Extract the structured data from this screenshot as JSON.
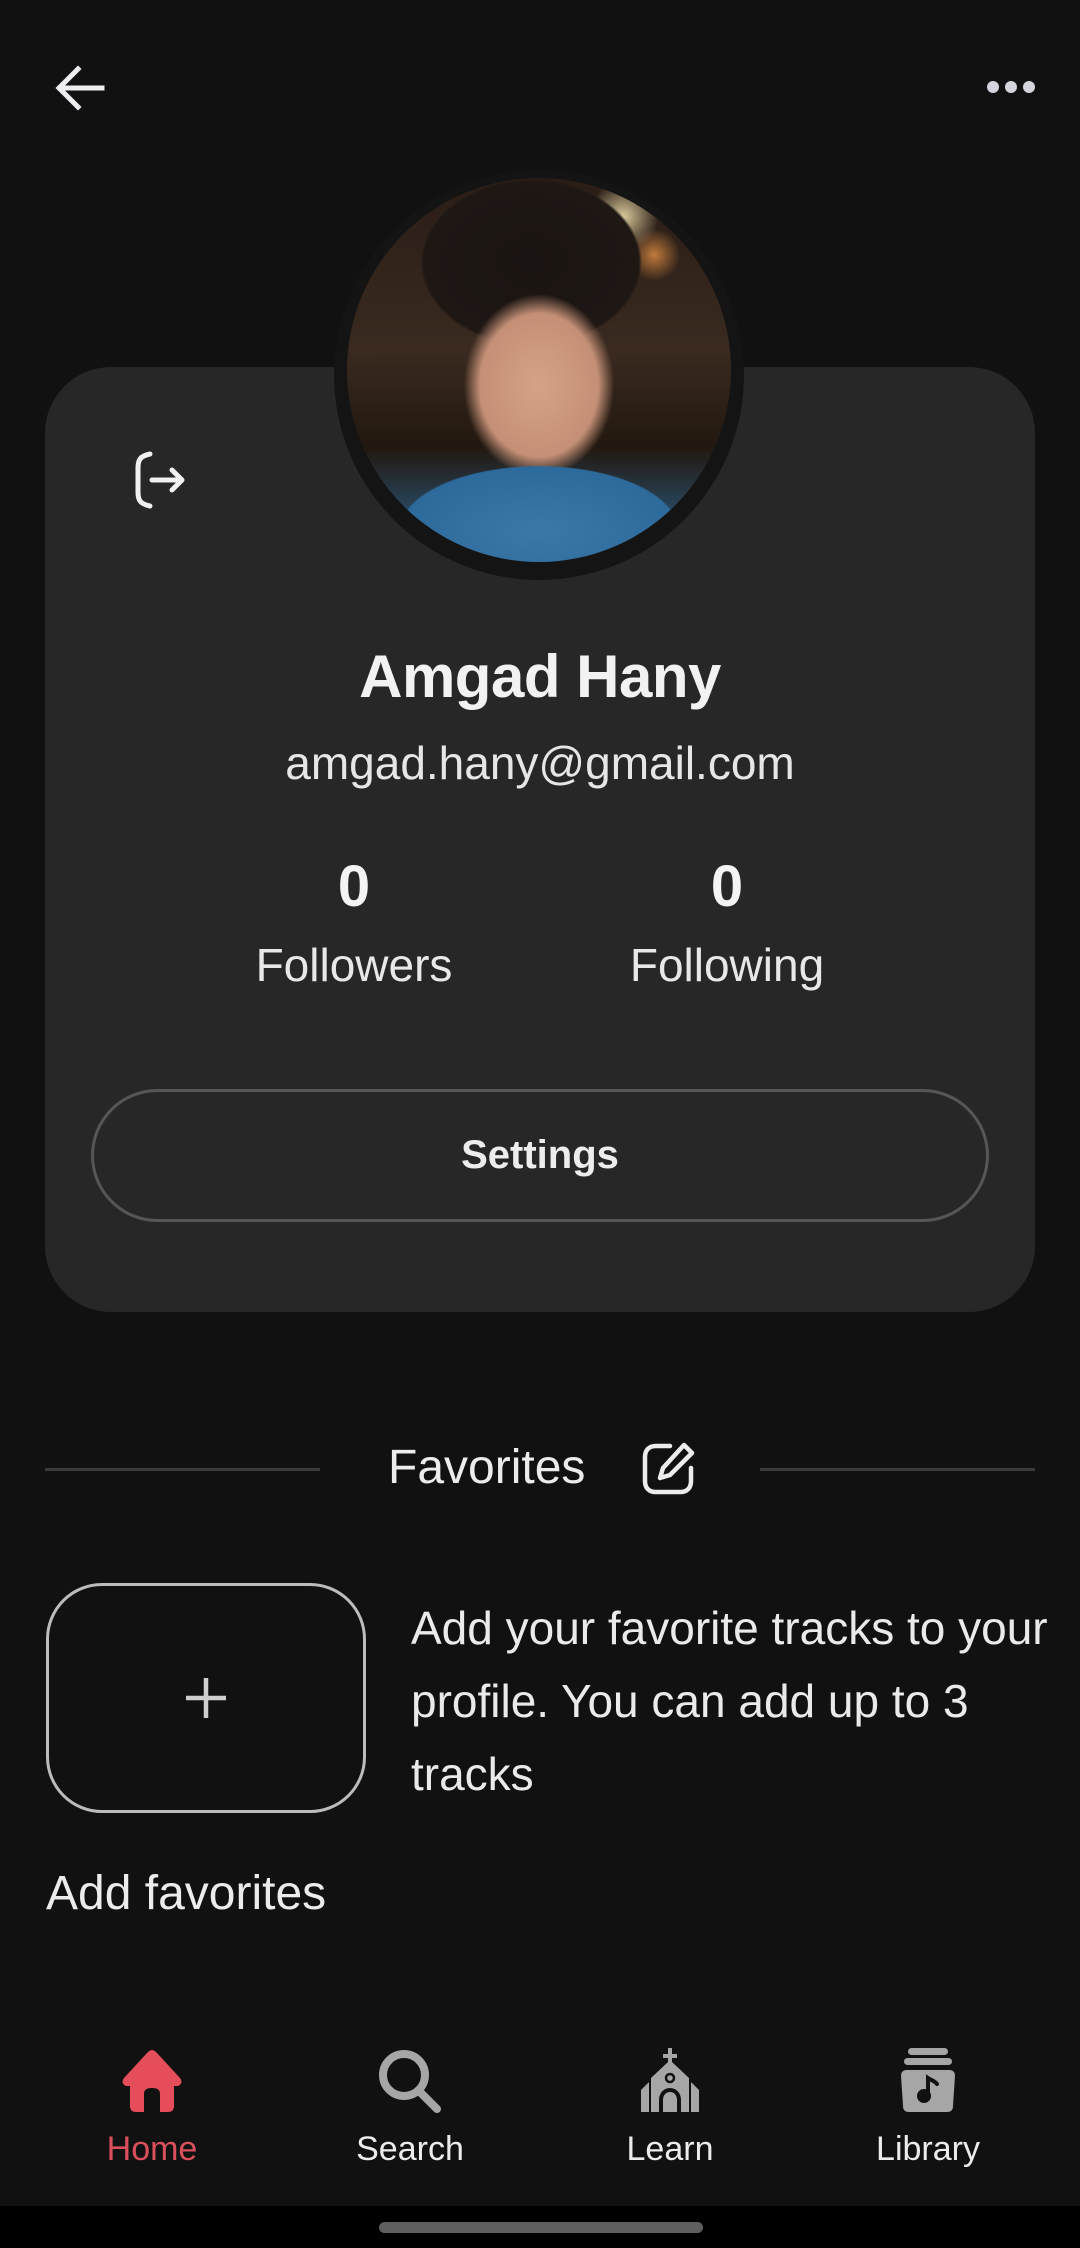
{
  "header": {
    "back_icon": "arrow-left-icon",
    "more_icon": "more-horizontal-icon"
  },
  "profile": {
    "name": "Amgad Hany",
    "email": "amgad.hany@gmail.com",
    "avatar_alt": "Profile photo of Amgad Hany",
    "logout_icon": "logout-icon",
    "stats": [
      {
        "value": "0",
        "label": "Followers"
      },
      {
        "value": "0",
        "label": "Following"
      }
    ],
    "settings_label": "Settings"
  },
  "favorites": {
    "title": "Favorites",
    "edit_icon": "edit-icon",
    "add_tile_symbol": "+",
    "description": "Add your favorite tracks to your profile. You can add up to 3 tracks",
    "add_label": "Add favorites"
  },
  "nav": {
    "active_color": "#e54d5a",
    "inactive_icon_color": "#a6a6a6",
    "items": [
      {
        "label": "Home",
        "icon": "home-icon",
        "active": true
      },
      {
        "label": "Search",
        "icon": "search-icon",
        "active": false
      },
      {
        "label": "Learn",
        "icon": "church-icon",
        "active": false
      },
      {
        "label": "Library",
        "icon": "library-icon",
        "active": false
      }
    ]
  },
  "colors": {
    "background": "#111111",
    "card": "#272727",
    "accent": "#e54d5a",
    "text": "#efeff0"
  }
}
